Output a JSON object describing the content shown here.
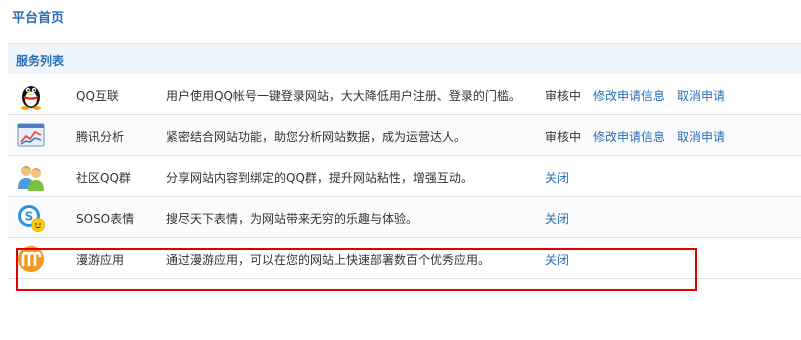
{
  "header": {
    "title": "平台首页"
  },
  "section": {
    "title": "服务列表"
  },
  "services": [
    {
      "icon": "qq-penguin-icon",
      "name": "QQ互联",
      "desc": "用户使用QQ帐号一键登录网站，大大降低用户注册、登录的门槛。",
      "status": "审核中",
      "link_a": "修改申请信息",
      "link_b": "取消申请"
    },
    {
      "icon": "analytics-chart-icon",
      "name": "腾讯分析",
      "desc": "紧密结合网站功能，助您分析网站数据，成为运营达人。",
      "status": "审核中",
      "link_a": "修改申请信息",
      "link_b": "取消申请"
    },
    {
      "icon": "community-group-icon",
      "name": "社区QQ群",
      "desc": "分享网站内容到绑定的QQ群，提升网站粘性，增强互动。",
      "close": "关闭"
    },
    {
      "icon": "soso-smiley-icon",
      "name": "SOSO表情",
      "desc": "搜尽天下表情，为网站带来无穷的乐趣与体验。",
      "close": "关闭"
    },
    {
      "icon": "manyou-m-icon",
      "name": "漫游应用",
      "desc": "通过漫游应用，可以在您的网站上快速部署数百个优秀应用。",
      "close": "关闭"
    }
  ],
  "colors": {
    "link": "#2a6fb5",
    "header_bg": "#eef5fb",
    "highlight": "#e40000"
  }
}
